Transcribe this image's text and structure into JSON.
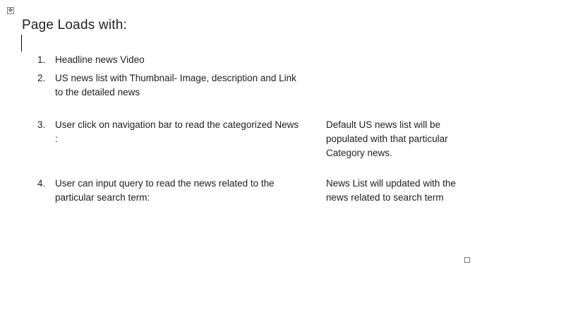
{
  "document": {
    "heading": "Page Loads with:",
    "items": [
      {
        "number": "1.",
        "text": "Headline news Video",
        "note": ""
      },
      {
        "number": "2.",
        "text": "US news list with Thumbnail- Image, description and Link to the detailed news",
        "note": ""
      },
      {
        "number": "3.",
        "text": "User  click on navigation bar to read the categorized News :",
        "note": "Default US news list will be populated with that particular Category news."
      },
      {
        "number": "4.",
        "text": "User can input query to read the news related  to the particular search term:",
        "note": "News List will updated  with the news related to search term"
      }
    ]
  },
  "icons": {
    "table_move_handle": "move-arrows-icon",
    "table_resize_handle": "resize-square-icon"
  }
}
